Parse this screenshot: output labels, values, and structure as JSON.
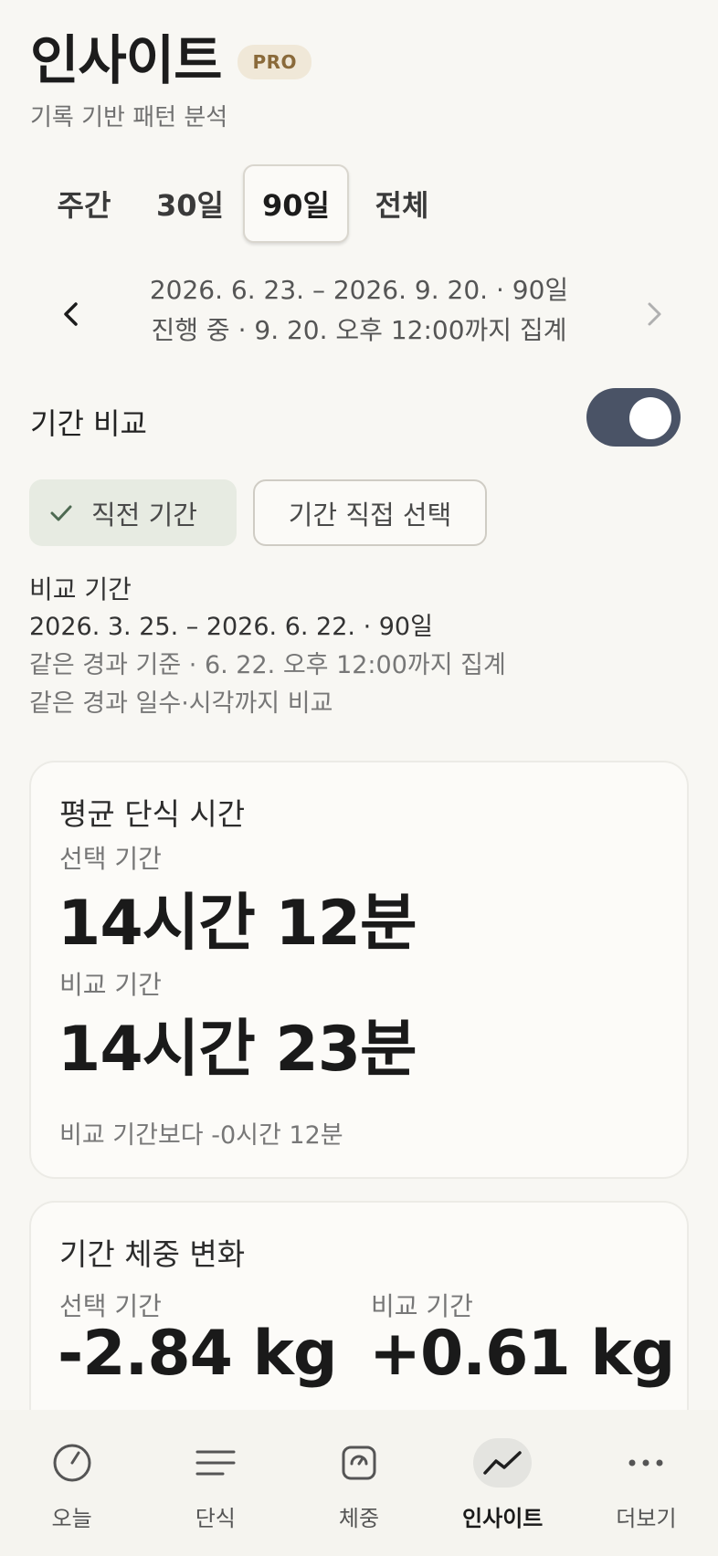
{
  "header": {
    "title": "인사이트",
    "badge": "PRO",
    "subtitle": "기록 기반 패턴 분석"
  },
  "range_tabs": [
    {
      "label": "주간",
      "active": false
    },
    {
      "label": "30일",
      "active": false
    },
    {
      "label": "90일",
      "active": true
    },
    {
      "label": "전체",
      "active": false
    }
  ],
  "period": {
    "range": "2026. 6. 23. – 2026. 9. 20. · 90일",
    "status": "진행 중 · 9. 20. 오후 12:00까지 집계"
  },
  "compare": {
    "label": "기간 비교",
    "enabled": true,
    "chips": {
      "previous": "직전 기간",
      "custom": "기간 직접 선택"
    },
    "info_title": "비교 기간",
    "info_range": "2026. 3. 25. – 2026. 6. 22. · 90일",
    "info_note1": "같은 경과 기준 · 6. 22. 오후 12:00까지 집계",
    "info_note2": "같은 경과 일수·시각까지 비교"
  },
  "fasting_card": {
    "title": "평균 단식 시간",
    "selected_label": "선택 기간",
    "selected_value": "14시간 12분",
    "compare_label": "비교 기간",
    "compare_value": "14시간 23분",
    "delta": "비교 기간보다 -0시간 12분"
  },
  "weight_card": {
    "title": "기간 체중 변화",
    "selected_label": "선택 기간",
    "selected_value": "-2.84 kg",
    "compare_label": "비교 기간",
    "compare_value": "+0.61 kg"
  },
  "bottom_nav": [
    {
      "label": "오늘",
      "icon": "clock-icon",
      "active": false
    },
    {
      "label": "단식",
      "icon": "list-icon",
      "active": false
    },
    {
      "label": "체중",
      "icon": "scale-icon",
      "active": false
    },
    {
      "label": "인사이트",
      "icon": "trend-icon",
      "active": true
    },
    {
      "label": "더보기",
      "icon": "more-icon",
      "active": false
    }
  ],
  "colors": {
    "background": "#f8f7f3",
    "toggle_on": "#4a5366",
    "chip_selected": "#e7ebe2",
    "badge_bg": "#f0e8d8",
    "badge_text": "#8a6a3a"
  }
}
